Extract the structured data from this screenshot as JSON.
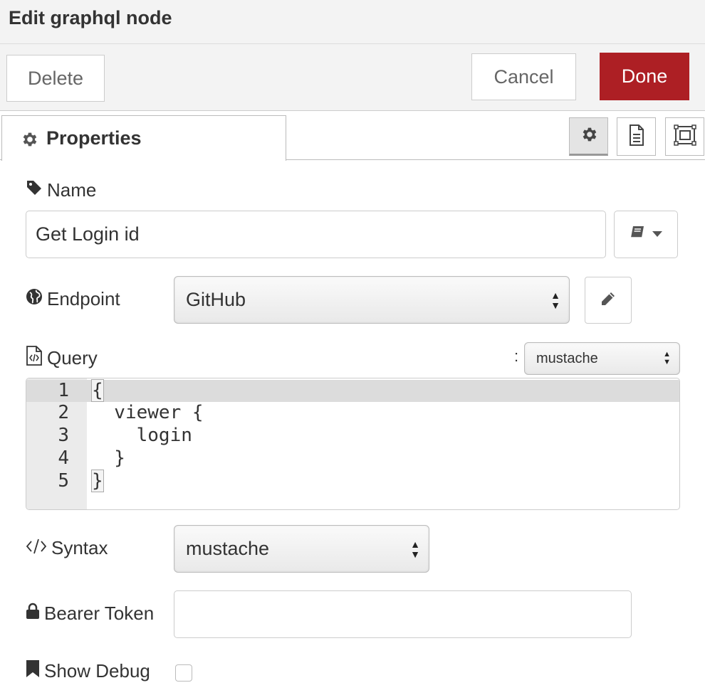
{
  "title": "Edit graphql node",
  "toolbar": {
    "delete_label": "Delete",
    "cancel_label": "Cancel",
    "done_label": "Done"
  },
  "tab": {
    "label": "Properties"
  },
  "side_buttons": [
    "gear-icon",
    "document-icon",
    "frame-icon"
  ],
  "fields": {
    "name": {
      "label": "Name",
      "value": "Get Login id"
    },
    "endpoint": {
      "label": "Endpoint",
      "value": "GitHub"
    },
    "query": {
      "label": "Query",
      "colon": ":",
      "format_value": "mustache",
      "lines": [
        {
          "num": "1",
          "text": "{"
        },
        {
          "num": "2",
          "text": "  viewer {"
        },
        {
          "num": "3",
          "text": "    login"
        },
        {
          "num": "4",
          "text": "  }"
        },
        {
          "num": "5",
          "text": "}"
        }
      ]
    },
    "syntax": {
      "label": "Syntax",
      "value": "mustache"
    },
    "bearer_token": {
      "label": "Bearer Token",
      "value": ""
    },
    "show_debug": {
      "label": "Show Debug",
      "checked": false
    }
  },
  "colors": {
    "done_bg": "#ad1f24",
    "header_bg": "#f3f3f3"
  }
}
